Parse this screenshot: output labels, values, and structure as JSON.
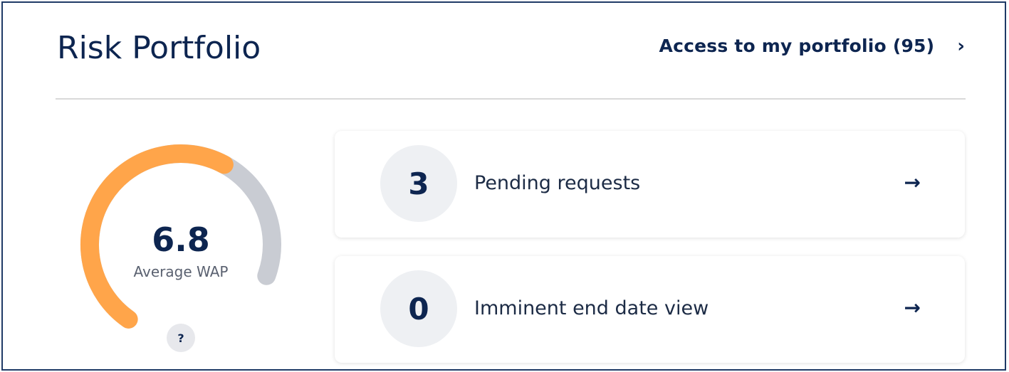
{
  "header": {
    "title": "Risk Portfolio",
    "access_link": "Access to my portfolio (95)",
    "access_chevron": "›"
  },
  "gauge": {
    "value": "6.8",
    "label": "Average WAP",
    "help": "?",
    "fill_fraction": 0.68,
    "colors": {
      "fill": "#ffa54a",
      "track": "#c9ccd3"
    }
  },
  "cards": [
    {
      "count": "3",
      "label": "Pending requests",
      "arrow": "→"
    },
    {
      "count": "0",
      "label": "Imminent end date view",
      "arrow": "→"
    }
  ],
  "colors": {
    "text_primary": "#0d2550",
    "frame_border": "#1f3a66"
  }
}
